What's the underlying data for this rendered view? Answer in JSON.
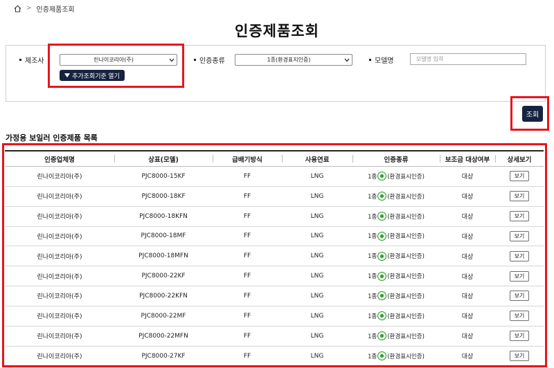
{
  "breadcrumb": {
    "current": "인증제품조회"
  },
  "page_title": "인증제품조회",
  "search": {
    "manufacturer_label": "제조사",
    "manufacturer_value": "린나이코리아(주)",
    "cert_type_label": "인증종류",
    "cert_type_value": "1종(환경표지인증)",
    "model_label": "모델명",
    "model_placeholder": "모델명 입력",
    "advanced_button": "추가조회기준 열기",
    "search_button": "조회"
  },
  "list_title": "가정용 보일러 인증제품 목록",
  "table": {
    "headers": [
      "인증업체명",
      "상표(모델)",
      "급배기방식",
      "사용연료",
      "인증종류",
      "보조금 대상여부",
      "상세보기"
    ],
    "cert_prefix": "1종",
    "cert_suffix": "(환경표시인증)",
    "view_label": "보기",
    "rows": [
      {
        "company": "린나이코리아(주)",
        "model": "PJC8000-15KF",
        "exhaust": "FF",
        "fuel": "LNG",
        "subsidy": "대상"
      },
      {
        "company": "린나이코리아(주)",
        "model": "PJC8000-18KF",
        "exhaust": "FF",
        "fuel": "LNG",
        "subsidy": "대상"
      },
      {
        "company": "린나이코리아(주)",
        "model": "PJC8000-18KFN",
        "exhaust": "FF",
        "fuel": "LNG",
        "subsidy": "대상"
      },
      {
        "company": "린나이코리아(주)",
        "model": "PJC8000-18MF",
        "exhaust": "FF",
        "fuel": "LNG",
        "subsidy": "대상"
      },
      {
        "company": "린나이코리아(주)",
        "model": "PJC8000-18MFN",
        "exhaust": "FF",
        "fuel": "LNG",
        "subsidy": "대상"
      },
      {
        "company": "린나이코리아(주)",
        "model": "PJC8000-22KF",
        "exhaust": "FF",
        "fuel": "LNG",
        "subsidy": "대상"
      },
      {
        "company": "린나이코리아(주)",
        "model": "PJC8000-22KFN",
        "exhaust": "FF",
        "fuel": "LNG",
        "subsidy": "대상"
      },
      {
        "company": "린나이코리아(주)",
        "model": "PJC8000-22MF",
        "exhaust": "FF",
        "fuel": "LNG",
        "subsidy": "대상"
      },
      {
        "company": "린나이코리아(주)",
        "model": "PJC8000-22MFN",
        "exhaust": "FF",
        "fuel": "LNG",
        "subsidy": "대상"
      },
      {
        "company": "린나이코리아(주)",
        "model": "PJC8000-27KF",
        "exhaust": "FF",
        "fuel": "LNG",
        "subsidy": "대상"
      }
    ]
  },
  "icons": {
    "home": "home-icon",
    "dropdown": "chevron-down-icon",
    "cert": "eco-label-icon",
    "expand": "triangle-down-icon"
  },
  "colors": {
    "primary_button": "#162340",
    "highlight_border": "#e8141c",
    "eco_green": "#2f9a34"
  }
}
